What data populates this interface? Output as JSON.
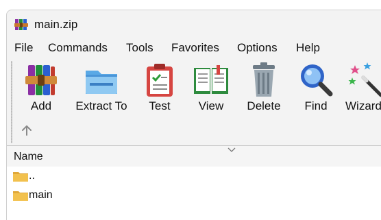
{
  "window": {
    "title": "main.zip"
  },
  "icons": {
    "app": "winrar-books-icon",
    "up": "arrow-up-icon",
    "sort": "chevron-down-icon",
    "folder": "folder-icon"
  },
  "menu": [
    "File",
    "Commands",
    "Tools",
    "Favorites",
    "Options",
    "Help"
  ],
  "toolbar": {
    "add": "Add",
    "extract_to": "Extract To",
    "test": "Test",
    "view": "View",
    "delete": "Delete",
    "find": "Find",
    "wizard": "Wizard"
  },
  "filelist": {
    "columns": [
      "Name"
    ],
    "rows": [
      {
        "name": ".."
      },
      {
        "name": "main"
      }
    ]
  },
  "colors": {
    "window_bg": "#f3f3f3",
    "list_bg": "#ffffff",
    "folder": "#f2c14e"
  }
}
